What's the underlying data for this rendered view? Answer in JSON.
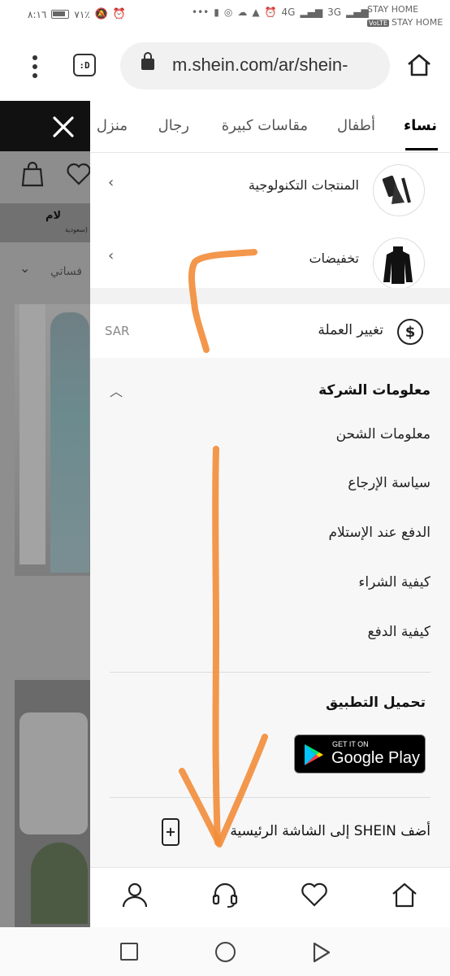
{
  "status_bar": {
    "time": "٨:١٦",
    "battery": "٧١٪",
    "network_4g": "4G",
    "network_3g": "3G",
    "carrier_1": "STAY HOME",
    "carrier_2": "STAY HOME",
    "volte": "VoLTE"
  },
  "browser": {
    "tabs_label": ":D",
    "url": "m.shein.com/ar/shein-"
  },
  "background_page": {
    "category_text": "فساتي",
    "banner_text": "لام",
    "banner_sub": "سعودية)"
  },
  "categories": [
    {
      "label": "نساء",
      "active": true
    },
    {
      "label": "أطفال",
      "active": false
    },
    {
      "label": "مقاسات كبيرة",
      "active": false
    },
    {
      "label": "رجال",
      "active": false
    },
    {
      "label": "منزل",
      "active": false
    }
  ],
  "menu_items": [
    {
      "label": "المنتجات التكنولوجية",
      "thumb": "phone-stand"
    },
    {
      "label": "تخفيضات",
      "thumb": "black-sweater"
    }
  ],
  "currency": {
    "label": "تغيير العملة",
    "value": "SAR",
    "icon": "dollar-icon"
  },
  "company_info": {
    "heading": "معلومات الشركة",
    "links": [
      "معلومات الشحن",
      "سياسة الإرجاع",
      "الدفع عند الإستلام",
      "كيفية الشراء",
      "كيفية الدفع"
    ]
  },
  "app_download": {
    "title": "تحميل التطبيق",
    "store_small": "GET IT ON",
    "store_big": "Google Play"
  },
  "add_to_home": {
    "label": "أضف SHEIN إلى الشاشة الرئيسية"
  },
  "colors": {
    "annotation": "#f28c38",
    "overlay": "#8e8e8e"
  }
}
